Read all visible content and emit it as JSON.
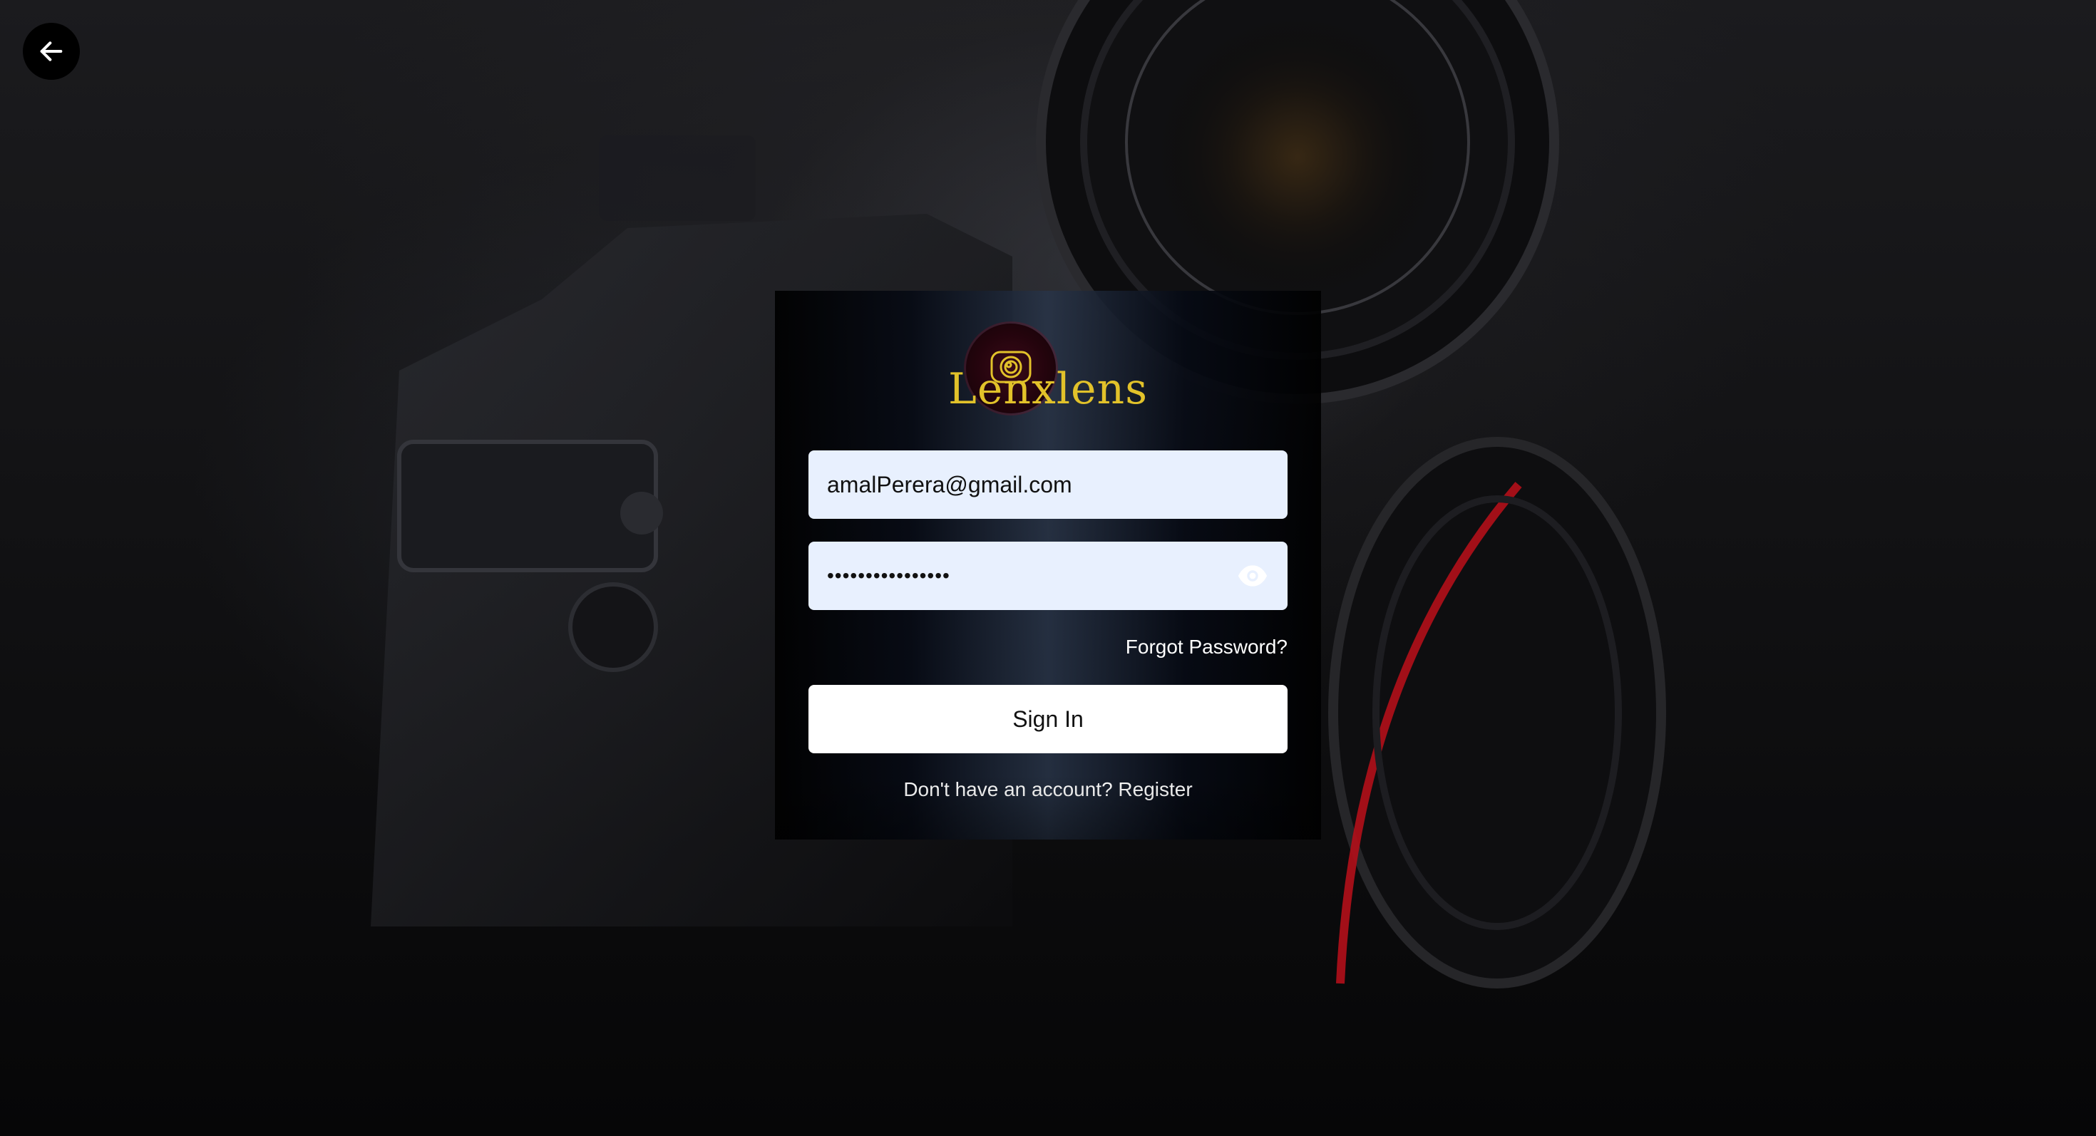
{
  "background": {
    "description_icon": "camera-background-icon"
  },
  "nav": {
    "back_icon": "arrow-left-icon"
  },
  "brand": {
    "name": "Lenxlens",
    "logo_icon": "camera-lens-icon",
    "color": "#e2c22a"
  },
  "form": {
    "email_value": "amalPerera@gmail.com",
    "password_value": "••••••••••••••••",
    "password_toggle_icon": "eye-icon",
    "forgot_label": "Forgot Password?",
    "submit_label": "Sign In",
    "register_prompt": "Don't have an account?",
    "register_link": "Register"
  },
  "colors": {
    "input_bg": "#e8f0fe",
    "button_bg": "#ffffff",
    "text_light": "#ffffff"
  }
}
